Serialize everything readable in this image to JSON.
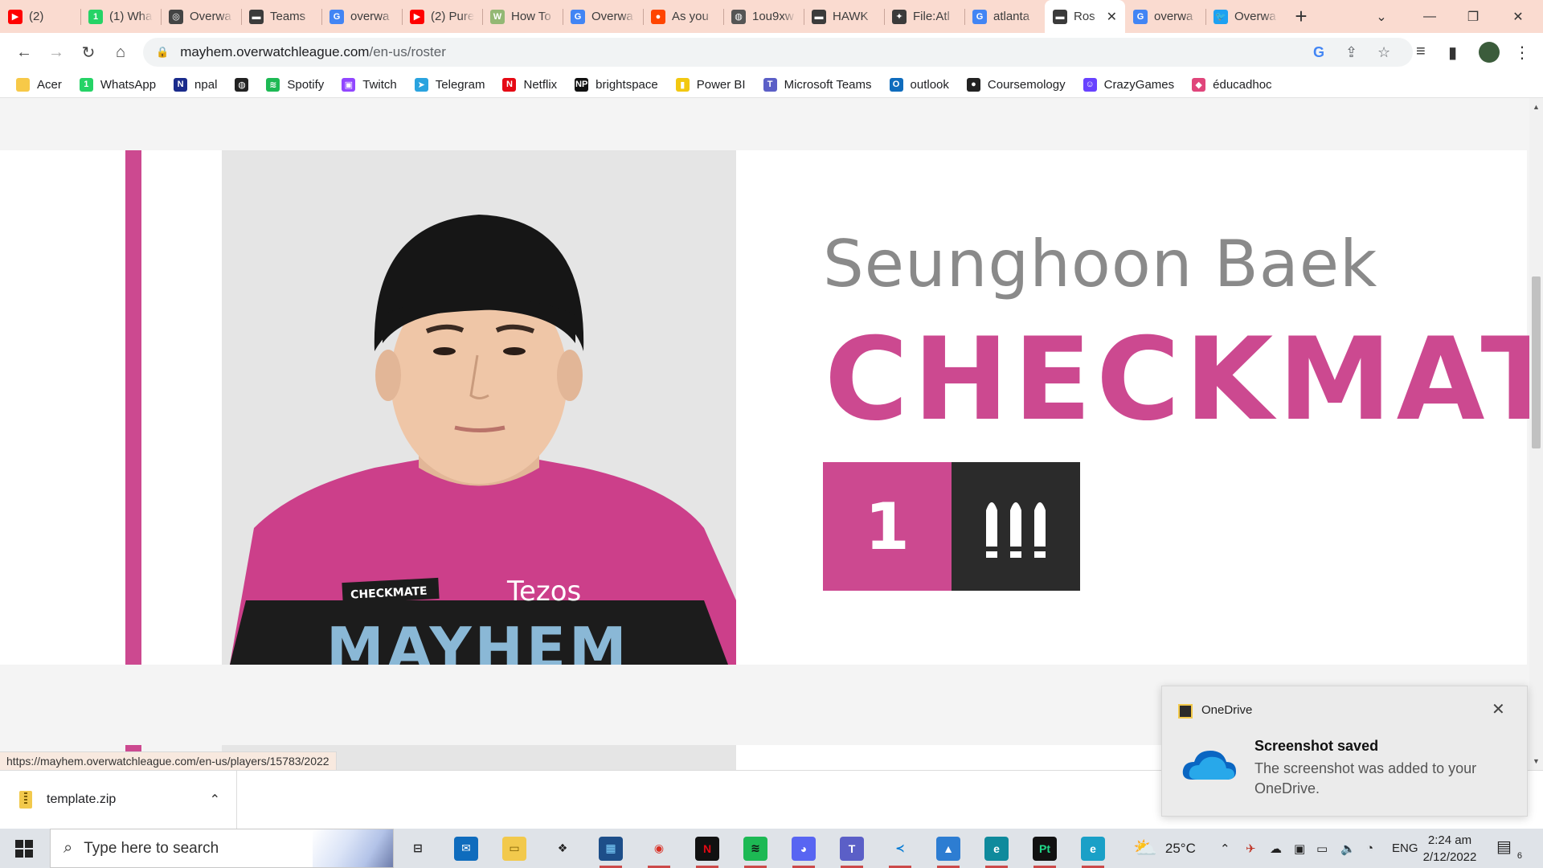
{
  "browser": {
    "tabs": [
      {
        "label": "(2)",
        "icon": "youtube-icon",
        "color": "#ff0000",
        "glyph": "▶"
      },
      {
        "label": "(1) Wha",
        "icon": "whatsapp-icon",
        "color": "#25d366",
        "glyph": "1"
      },
      {
        "label": "Overwa",
        "icon": "overwatch-icon",
        "color": "#444444",
        "glyph": "◎"
      },
      {
        "label": "Teams",
        "icon": "teams-flag-icon",
        "color": "#3b3b3b",
        "glyph": "▬"
      },
      {
        "label": "overwa",
        "icon": "google-icon",
        "color": "#4285f4",
        "glyph": "G"
      },
      {
        "label": "(2) Pure",
        "icon": "youtube-icon",
        "color": "#ff0000",
        "glyph": "▶"
      },
      {
        "label": "How To",
        "icon": "wikihow-icon",
        "color": "#93b874",
        "glyph": "W"
      },
      {
        "label": "Overwa",
        "icon": "google-icon",
        "color": "#4285f4",
        "glyph": "G"
      },
      {
        "label": "As you",
        "icon": "reddit-icon",
        "color": "#ff4500",
        "glyph": "●"
      },
      {
        "label": "1ou9xw",
        "icon": "globe-icon",
        "color": "#555555",
        "glyph": "◍"
      },
      {
        "label": "HAWK",
        "icon": "flag-icon",
        "color": "#3b3b3b",
        "glyph": "▬"
      },
      {
        "label": "File:Atl",
        "icon": "wiki-icon",
        "color": "#3b3b3b",
        "glyph": "✦"
      },
      {
        "label": "atlanta",
        "icon": "google-icon",
        "color": "#4285f4",
        "glyph": "G"
      },
      {
        "label": "Ros",
        "icon": "roster-icon",
        "color": "#3b3b3b",
        "glyph": "▬",
        "active": true
      },
      {
        "label": "overwa",
        "icon": "google-icon",
        "color": "#4285f4",
        "glyph": "G"
      },
      {
        "label": "Overwa",
        "icon": "twitter-icon",
        "color": "#1da1f2",
        "glyph": "🐦"
      }
    ],
    "active_tab_close": "✕",
    "new_tab": "+",
    "url_host": "mayhem.overwatchleague.com",
    "url_path": "/en-us/roster",
    "bookmarks": [
      {
        "label": "Acer",
        "icon": "folder-icon",
        "color": "#f7c948",
        "glyph": ""
      },
      {
        "label": "WhatsApp",
        "icon": "whatsapp-icon",
        "color": "#25d366",
        "glyph": "1"
      },
      {
        "label": "npal",
        "icon": "npal-icon",
        "color": "#1a2b8c",
        "glyph": "N"
      },
      {
        "label": "",
        "icon": "globe-icon",
        "color": "#222222",
        "glyph": "◍"
      },
      {
        "label": "Spotify",
        "icon": "spotify-icon",
        "color": "#1db954",
        "glyph": "≋"
      },
      {
        "label": "Twitch",
        "icon": "twitch-icon",
        "color": "#9146ff",
        "glyph": "▣"
      },
      {
        "label": "Telegram",
        "icon": "telegram-icon",
        "color": "#2aa3df",
        "glyph": "➤"
      },
      {
        "label": "Netflix",
        "icon": "netflix-icon",
        "color": "#e50914",
        "glyph": "N"
      },
      {
        "label": "brightspace",
        "icon": "brightspace-icon",
        "color": "#111111",
        "glyph": "NP"
      },
      {
        "label": "Power BI",
        "icon": "powerbi-icon",
        "color": "#f2c811",
        "glyph": "▮"
      },
      {
        "label": "Microsoft Teams",
        "icon": "teams-icon",
        "color": "#5b5fc7",
        "glyph": "T"
      },
      {
        "label": "outlook",
        "icon": "outlook-icon",
        "color": "#0f6cbd",
        "glyph": "O"
      },
      {
        "label": "Coursemology",
        "icon": "coursemology-icon",
        "color": "#222222",
        "glyph": "●"
      },
      {
        "label": "CrazyGames",
        "icon": "crazygames-icon",
        "color": "#6842ff",
        "glyph": "☺"
      },
      {
        "label": "éducadhoc",
        "icon": "educadhoc-icon",
        "color": "#e0457b",
        "glyph": "◆"
      }
    ]
  },
  "page": {
    "player_real_name": "Seunghoon Baek",
    "player_handle": "CHECKMATE",
    "player_number": "1",
    "role_icon": "damage-role-icon",
    "accent_color": "#cc4990",
    "role_box_color": "#2b2b2b",
    "jersey": {
      "nameplate": "CHECKMATE",
      "sponsor": "Tezos",
      "team": "MAYHEM"
    }
  },
  "status_url": "https://mayhem.overwatchleague.com/en-us/players/15783/2022",
  "downloads": {
    "file_name": "template.zip"
  },
  "toast": {
    "app": "OneDrive",
    "heading": "Screenshot saved",
    "body": "The screenshot was added to your OneDrive."
  },
  "taskbar": {
    "search_placeholder": "Type here to search",
    "weather_temp": "25°C",
    "language": "ENG",
    "time": "2:24 am",
    "date": "2/12/2022",
    "notification_count": "6",
    "apps": [
      {
        "name": "task-view",
        "color": "#dfe3e8",
        "glyph": "⊟",
        "fg": "#222"
      },
      {
        "name": "mail",
        "color": "#0f6cbd",
        "glyph": "✉",
        "fg": "#fff"
      },
      {
        "name": "file-explorer",
        "color": "#f2c94c",
        "glyph": "▭",
        "fg": "#7a5b00"
      },
      {
        "name": "dropbox",
        "color": "#dfe3e8",
        "glyph": "❖",
        "fg": "#222"
      },
      {
        "name": "codeblocks",
        "color": "#1d4e89",
        "glyph": "▦",
        "fg": "#7fd3ff"
      },
      {
        "name": "chrome",
        "color": "#dfe3e8",
        "glyph": "◉",
        "fg": "#d93025"
      },
      {
        "name": "netflix",
        "color": "#111111",
        "glyph": "N",
        "fg": "#e50914"
      },
      {
        "name": "spotify",
        "color": "#1db954",
        "glyph": "≋",
        "fg": "#111"
      },
      {
        "name": "discord",
        "color": "#5865f2",
        "glyph": "◕",
        "fg": "#fff"
      },
      {
        "name": "teams",
        "color": "#5b5fc7",
        "glyph": "T",
        "fg": "#fff"
      },
      {
        "name": "vscode",
        "color": "#dfe3e8",
        "glyph": "≺",
        "fg": "#0078d4"
      },
      {
        "name": "photos",
        "color": "#2d7dd2",
        "glyph": "▲",
        "fg": "#fff"
      },
      {
        "name": "edge",
        "color": "#0f8a9c",
        "glyph": "e",
        "fg": "#fff"
      },
      {
        "name": "pycharm",
        "color": "#111111",
        "glyph": "Pt",
        "fg": "#21d789"
      },
      {
        "name": "edge-dev",
        "color": "#1aa0c7",
        "glyph": "e",
        "fg": "#fff"
      }
    ]
  }
}
